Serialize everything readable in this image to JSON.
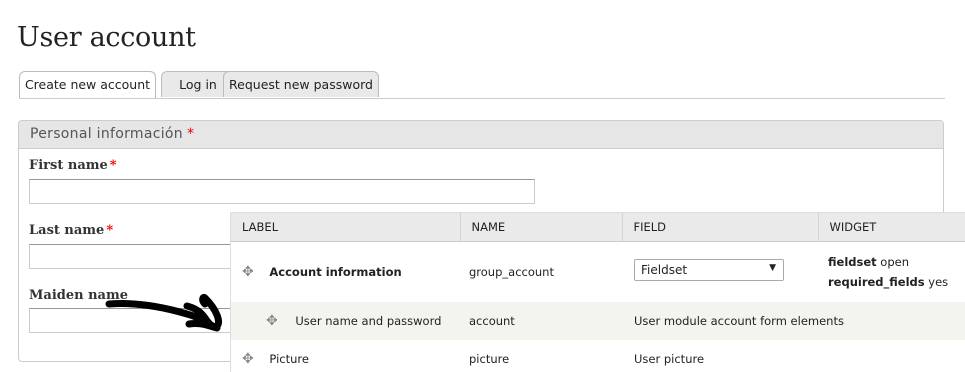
{
  "page": {
    "title": "User account"
  },
  "tabs": [
    {
      "label": "Create new account",
      "active": true
    },
    {
      "label": "Log in",
      "active": false
    },
    {
      "label": "Request new password",
      "active": false
    }
  ],
  "fieldset": {
    "legend": "Personal información",
    "required_marker": "*"
  },
  "form": {
    "first_name": {
      "label": "First name",
      "required_marker": "*",
      "value": ""
    },
    "last_name": {
      "label": "Last name",
      "required_marker": "*",
      "value": ""
    },
    "maiden_name": {
      "label": "Maiden name",
      "value": ""
    }
  },
  "table": {
    "headers": [
      "LABEL",
      "NAME",
      "FIELD",
      "WIDGET"
    ],
    "rows": [
      {
        "label": "Account information",
        "name": "group_account",
        "field_select": "Fieldset",
        "widget": [
          {
            "key": "fieldset",
            "value": "open"
          },
          {
            "key": "required_fields",
            "value": "yes"
          }
        ]
      },
      {
        "label": "User name and password",
        "name": "account",
        "field": "User module account form elements"
      },
      {
        "label": "Picture",
        "name": "picture",
        "field": "User picture"
      }
    ]
  },
  "icons": {
    "drag": "drag-handle-icon",
    "dropdown": "dropdown-arrow-icon"
  },
  "colors": {
    "required": "#ee0000",
    "header_bg": "#eaeaea",
    "highlight_row": "#f3f4ee"
  }
}
